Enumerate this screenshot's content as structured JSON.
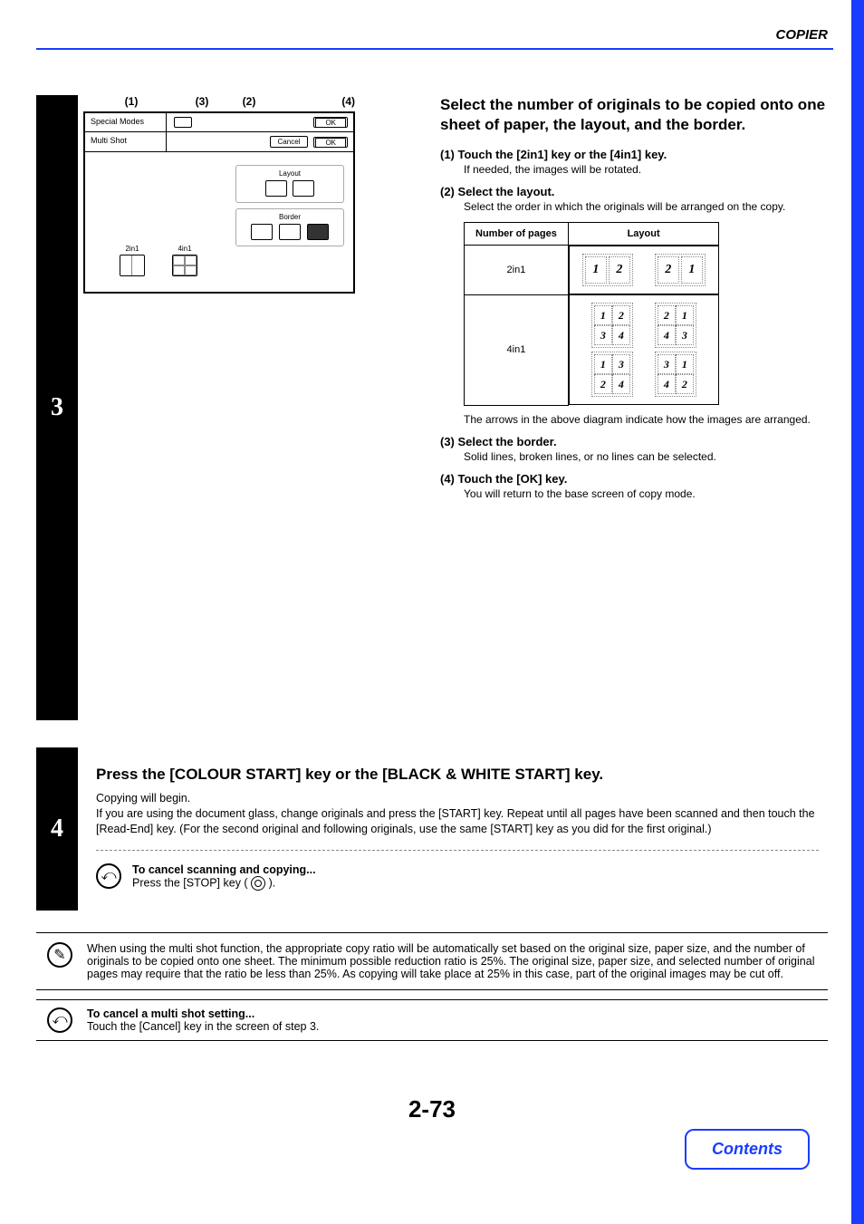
{
  "header": {
    "section": "COPIER"
  },
  "callouts": {
    "c1": "(1)",
    "c2": "(2)",
    "c3": "(3)",
    "c4": "(4)"
  },
  "screen": {
    "special_modes": "Special Modes",
    "multi_shot": "Multi Shot",
    "ok_top": "OK",
    "cancel": "Cancel",
    "ok": "OK",
    "layout": "Layout",
    "border": "Border",
    "key_2in1": "2in1",
    "key_4in1": "4in1"
  },
  "step3": {
    "badge": "3",
    "title": "Select the number of originals to be copied onto one sheet of paper, the layout, and the border.",
    "s1_h": "(1)  Touch the [2in1] key or the [4in1] key.",
    "s1_b": "If needed, the images will be rotated.",
    "s2_h": "(2)  Select the layout.",
    "s2_b": "Select the order in which the originals will be arranged on the copy.",
    "table": {
      "th1": "Number of pages",
      "th2": "Layout",
      "r1": "2in1",
      "r2": "4in1",
      "n1": "1",
      "n2": "2",
      "n3": "3",
      "n4": "4"
    },
    "caption": "The arrows in the above diagram indicate how the images are arranged.",
    "s3_h": "(3)  Select the border.",
    "s3_b": "Solid lines, broken lines, or no lines can be selected.",
    "s4_h": "(4)  Touch the [OK] key.",
    "s4_b": "You will return to the base screen of copy mode."
  },
  "step4": {
    "badge": "4",
    "title": "Press the [COLOUR START] key or the [BLACK & WHITE START] key.",
    "line1": "Copying will begin.",
    "line2": "If you are using the document glass, change originals and press the [START] key. Repeat until all pages have been scanned and then touch the [Read-End] key. (For the second original and following originals, use the same [START] key as you did for the first original.)",
    "cancel_h": "To cancel scanning and copying...",
    "cancel_b_pre": "Press the [STOP] key (",
    "cancel_b_post": ")."
  },
  "info": {
    "text": "When using the multi shot function, the appropriate copy ratio will be automatically set based on the original size, paper size, and the number of originals to be copied onto one sheet. The minimum possible reduction ratio is 25%. The original size, paper size, and selected number of original pages may require that the ratio be less than 25%. As copying will take place at 25% in this case, part of the original images may be cut off."
  },
  "cancel2": {
    "h": "To cancel a multi shot setting...",
    "b": "Touch the [Cancel] key in the screen of step 3."
  },
  "footer": {
    "page": "2-73",
    "contents": "Contents"
  }
}
